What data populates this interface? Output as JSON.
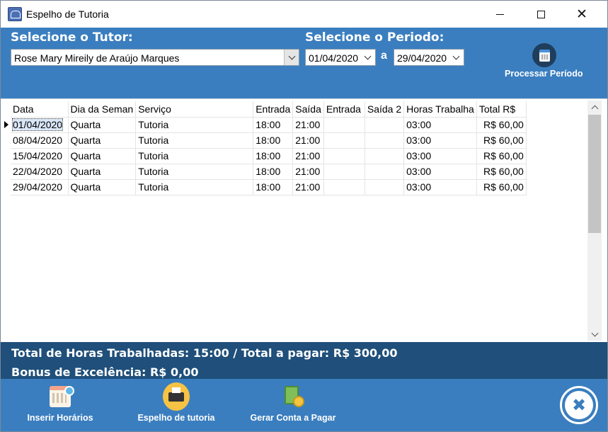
{
  "window": {
    "title": "Espelho de Tutoria",
    "icons": {
      "app": "graduation-cap-icon",
      "minimize": "minimize-icon",
      "maximize": "maximize-icon",
      "close": "close-icon"
    }
  },
  "header": {
    "tutor_label": "Selecione o Tutor:",
    "tutor_value": "Rose Mary Mireily de Araújo Marques",
    "periodo_label": "Selecione o Periodo:",
    "date_start": "01/04/2020",
    "date_separator": "a",
    "date_end": "29/04/2020",
    "process_label": "Processar Período"
  },
  "grid": {
    "columns": [
      "Data",
      "Dia da Seman",
      "Serviço",
      "Entrada",
      "Saída",
      "Entrada",
      "Saída 2",
      "Horas Trabalha",
      "Total R$"
    ],
    "rows": [
      [
        "01/04/2020",
        "Quarta",
        "Tutoria",
        "18:00",
        "21:00",
        "",
        "",
        "03:00",
        "R$ 60,00"
      ],
      [
        "08/04/2020",
        "Quarta",
        "Tutoria",
        "18:00",
        "21:00",
        "",
        "",
        "03:00",
        "R$ 60,00"
      ],
      [
        "15/04/2020",
        "Quarta",
        "Tutoria",
        "18:00",
        "21:00",
        "",
        "",
        "03:00",
        "R$ 60,00"
      ],
      [
        "22/04/2020",
        "Quarta",
        "Tutoria",
        "18:00",
        "21:00",
        "",
        "",
        "03:00",
        "R$ 60,00"
      ],
      [
        "29/04/2020",
        "Quarta",
        "Tutoria",
        "18:00",
        "21:00",
        "",
        "",
        "03:00",
        "R$ 60,00"
      ]
    ]
  },
  "totals": {
    "total_line": "Total de Horas Trabalhadas: 15:00 / Total a pagar: R$ 300,00",
    "bonus_line": "Bonus de Excelência: R$ 0,00"
  },
  "toolbar": {
    "inserir_label": "Inserir Horários",
    "espelho_label": "Espelho de tutoria",
    "gerar_label": "Gerar Conta a Pagar",
    "close_glyph": "✖"
  },
  "colors": {
    "header_bg": "#3a7ebf",
    "totals_bg": "#1f4f7a",
    "toolbar_bg": "#3a7ebf"
  }
}
